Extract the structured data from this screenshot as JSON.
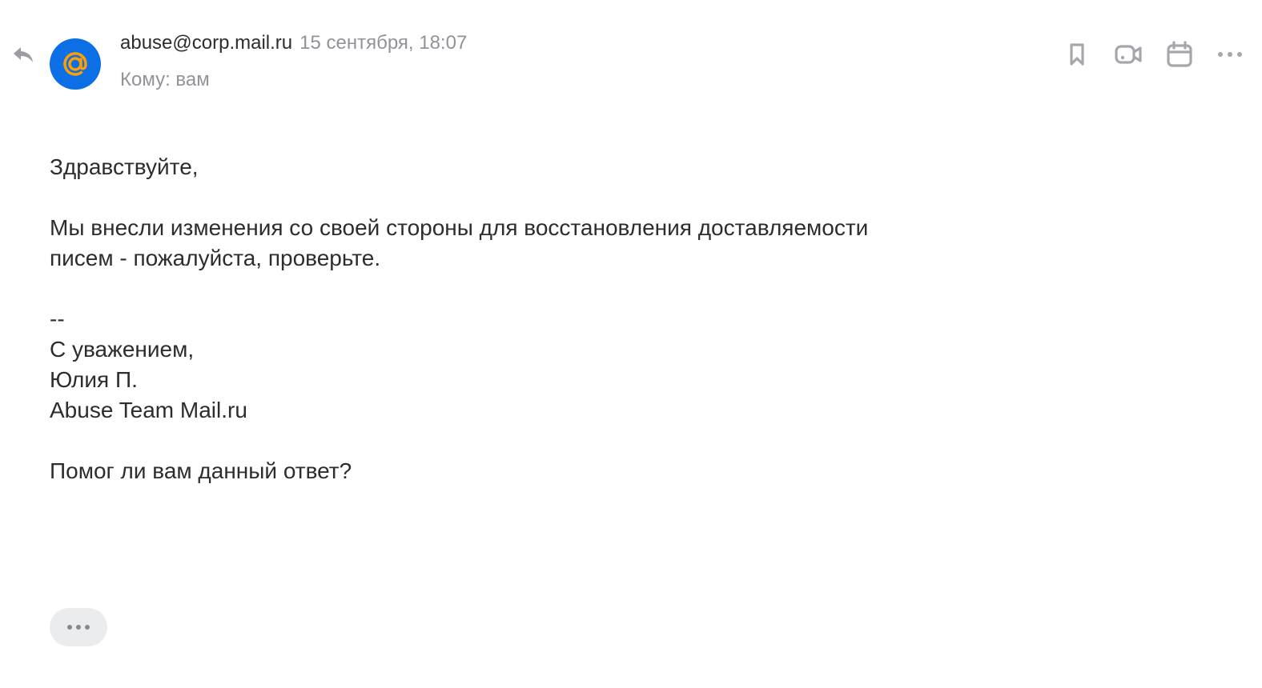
{
  "message": {
    "sender": "abuse@corp.mail.ru",
    "date": "15 сентября, 18:07",
    "recipient": "Кому: вам",
    "avatar_icon": "at-sign-icon",
    "avatar_color": "#0c6fe6",
    "avatar_accent": "#ff9e00"
  },
  "toolbar": {
    "icons": [
      "reply-icon",
      "bookmark-icon",
      "video-call-icon",
      "calendar-icon",
      "more-icon"
    ]
  },
  "body": {
    "greeting": "Здравствуйте,",
    "line1": "Мы внесли изменения со своей стороны для восстановления доставляемости",
    "line2": "писем - пожалуйста, проверьте.",
    "separator": "--",
    "regards": "С уважением,",
    "name": "Юлия П.",
    "team": "Abuse Team Mail.ru",
    "question": "Помог ли вам данный ответ?"
  },
  "expand_button": {
    "icon": "ellipsis-icon"
  }
}
